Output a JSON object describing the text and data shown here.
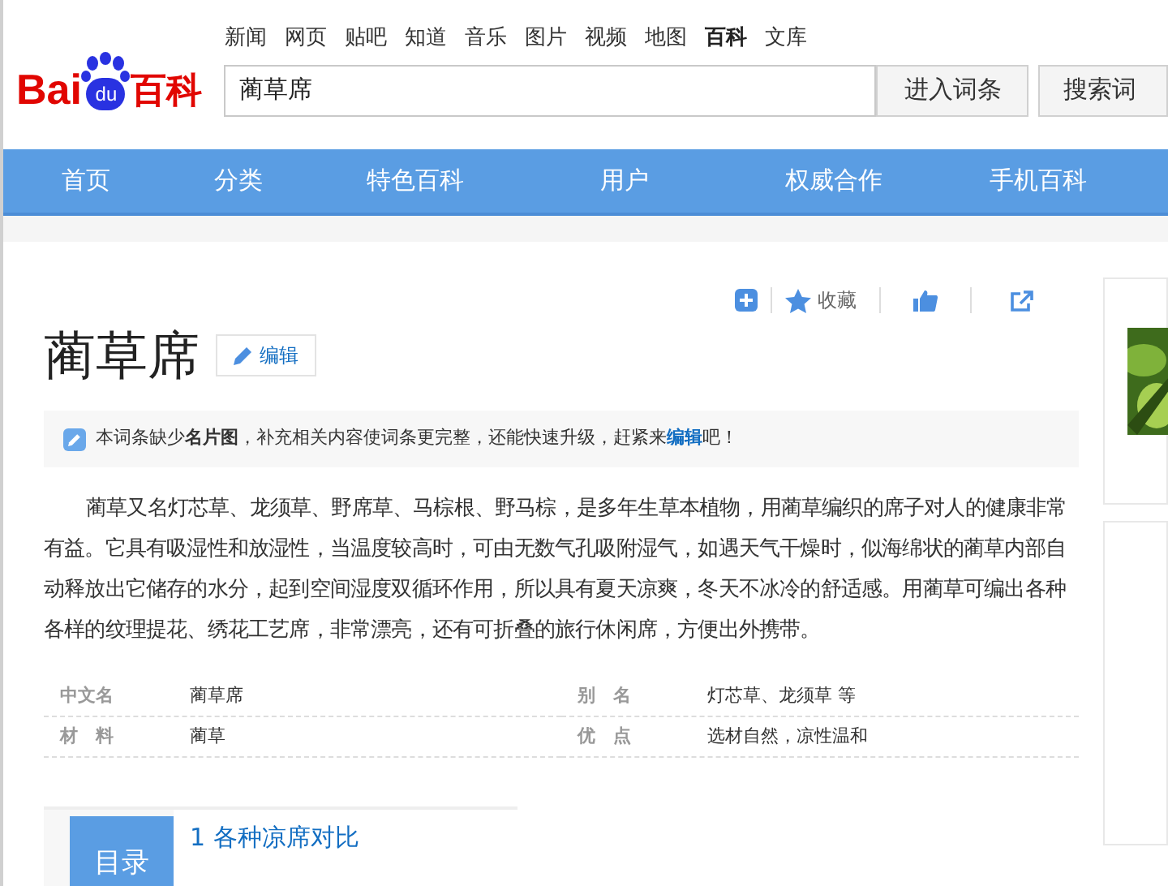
{
  "top_links": [
    {
      "label": "新闻",
      "selected": false
    },
    {
      "label": "网页",
      "selected": false
    },
    {
      "label": "贴吧",
      "selected": false
    },
    {
      "label": "知道",
      "selected": false
    },
    {
      "label": "音乐",
      "selected": false
    },
    {
      "label": "图片",
      "selected": false
    },
    {
      "label": "视频",
      "selected": false
    },
    {
      "label": "地图",
      "selected": false
    },
    {
      "label": "百科",
      "selected": true
    },
    {
      "label": "文库",
      "selected": false
    }
  ],
  "logo": {
    "brand_a": "Bai",
    "brand_b": "du",
    "brand_c": "百科"
  },
  "search": {
    "value": "蔺草席",
    "buttons": [
      "进入词条",
      "搜索词"
    ]
  },
  "nav": [
    "首页",
    "分类",
    "特色百科",
    "用户",
    "权威合作",
    "手机百科"
  ],
  "actions": {
    "favorite": "收藏"
  },
  "title": "蔺草席",
  "edit_button": "编辑",
  "notice": "本词条缺少**名片图**，补充相关内容使词条更完整，还能快速升级，赶紧来",
  "notice_link": "编辑",
  "notice_tail": "吧！",
  "summary": "蔺草又名灯芯草、龙须草、野席草、马棕根、野马棕，是多年生草本植物，用蔺草编织的席子对人的健康非常有益。它具有吸湿性和放湿性，当温度较高时，可由无数气孔吸附湿气，如遇天气干燥时，似海绵状的蔺草内部自动释放出它储存的水分，起到空间湿度双循环作用，所以具有夏天凉爽，冬天不冰冷的舒适感。用蔺草可编出各种各样的纹理提花、绣花工艺席，非常漂亮，还有可折叠的旅行休闲席，方便出外携带。",
  "basic_info": [
    {
      "name": "中文名",
      "value": "蔺草席"
    },
    {
      "name": "别　名",
      "value": "灯芯草、龙须草 等"
    },
    {
      "name": "材　料",
      "value": "蔺草"
    },
    {
      "name": "优　点",
      "value": "选材自然，凉性温和"
    }
  ],
  "toc": {
    "label": "目录",
    "items": [
      {
        "number": "1",
        "title": "各种凉席对比"
      }
    ]
  }
}
